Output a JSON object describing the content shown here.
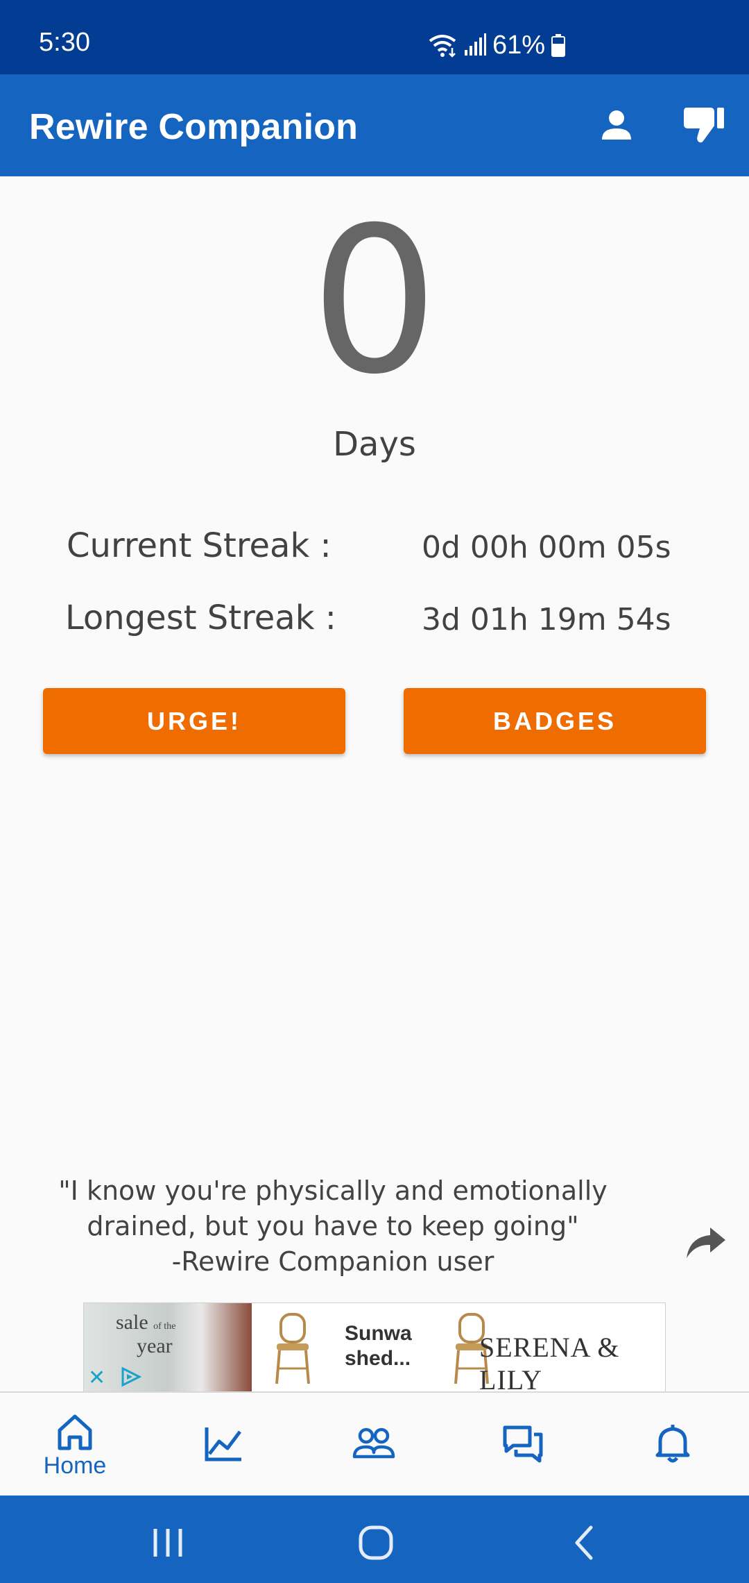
{
  "status_bar": {
    "time": "5:30",
    "battery": "61%"
  },
  "app_bar": {
    "title": "Rewire Companion",
    "icons": [
      "person-icon",
      "thumbs-down-icon"
    ]
  },
  "counter": {
    "value": "0",
    "unit": "Days"
  },
  "streaks": {
    "current_label": "Current Streak :",
    "current_value": "0d 00h 00m 05s",
    "longest_label": "Longest Streak :",
    "longest_value": "3d 01h 19m 54s"
  },
  "buttons": {
    "urge": "URGE!",
    "badges": "BADGES"
  },
  "quote": {
    "line1": "\"I know you're physically and emotionally",
    "line2": "drained, but you have to keep going\"",
    "line3": "-Rewire Companion user"
  },
  "ad": {
    "sale_line1": "sale",
    "sale_of": "of the",
    "sale_line2": "year",
    "headline_line1": "Sunwa",
    "headline_line2": "shed...",
    "brand": "SERENA & LILY"
  },
  "bottom_nav": {
    "home_label": "Home",
    "icons": [
      "home-icon",
      "chart-icon",
      "community-icon",
      "chat-icon",
      "bell-icon"
    ]
  },
  "colors": {
    "status_bar": "#023d93",
    "app_bar": "#1565c0",
    "accent_button": "#ef6c00",
    "nav_active": "#1565c0"
  }
}
